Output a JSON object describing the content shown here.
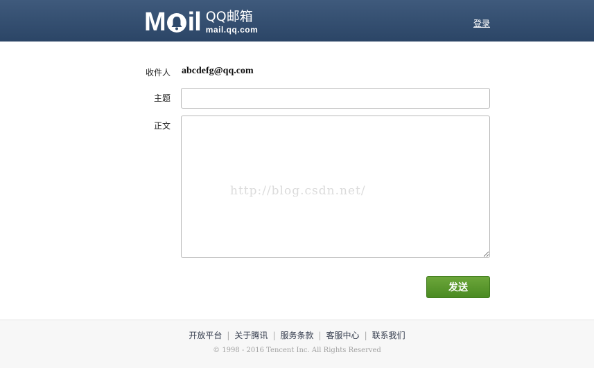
{
  "header": {
    "logo_word_left": "M",
    "logo_word_right": "il",
    "logo_cn": "QQ邮箱",
    "logo_domain": "mail.qq.com",
    "login_label": "登录",
    "colors": {
      "bar_top": "#3f5a7c",
      "bar_bottom": "#2b4566"
    }
  },
  "form": {
    "recipient_label": "收件人",
    "recipient_value": "abcdefg@qq.com",
    "subject_label": "主题",
    "subject_value": "",
    "body_label": "正文",
    "body_value": "",
    "watermark": "http://blog.csdn.net/",
    "send_label": "发送",
    "send_color": "#5a9a2e"
  },
  "footer": {
    "links": [
      "开放平台",
      "关于腾讯",
      "服务条款",
      "客服中心",
      "联系我们"
    ],
    "separator": "|",
    "copyright": "© 1998 - 2016 Tencent Inc. All Rights Reserved"
  }
}
